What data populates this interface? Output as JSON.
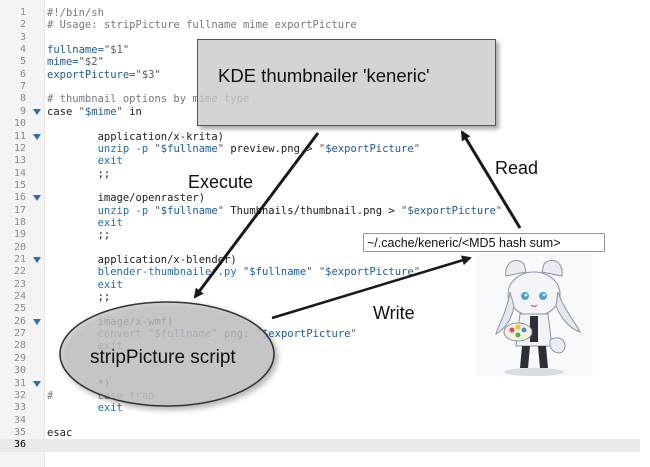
{
  "code_lines": [
    {
      "n": "1",
      "fold": false,
      "parts": [
        {
          "t": "#!/bin/sh",
          "c": "c-comment"
        }
      ]
    },
    {
      "n": "2",
      "fold": false,
      "parts": [
        {
          "t": "# Usage: stripPicture fullname mime exportPicture",
          "c": "c-comment"
        }
      ]
    },
    {
      "n": "3",
      "fold": false,
      "parts": []
    },
    {
      "n": "4",
      "fold": false,
      "parts": [
        {
          "t": "fullname=",
          "c": "c-var"
        },
        {
          "t": "\"$1\"",
          "c": "c-str"
        }
      ]
    },
    {
      "n": "5",
      "fold": false,
      "parts": [
        {
          "t": "mime=",
          "c": "c-var"
        },
        {
          "t": "\"$2\"",
          "c": "c-str"
        }
      ]
    },
    {
      "n": "6",
      "fold": false,
      "parts": [
        {
          "t": "exportPicture=",
          "c": "c-var"
        },
        {
          "t": "\"$3\"",
          "c": "c-str"
        }
      ]
    },
    {
      "n": "7",
      "fold": false,
      "parts": []
    },
    {
      "n": "8",
      "fold": false,
      "parts": [
        {
          "t": "# thumbnail options by mime type",
          "c": "c-comment"
        }
      ]
    },
    {
      "n": "9",
      "fold": true,
      "parts": [
        {
          "t": "case ",
          "c": "c-kw"
        },
        {
          "t": "\"",
          "c": "c-str"
        },
        {
          "t": "$mime",
          "c": "c-var"
        },
        {
          "t": "\"",
          "c": "c-str"
        },
        {
          "t": " in",
          "c": "c-kw"
        }
      ]
    },
    {
      "n": "10",
      "fold": false,
      "parts": []
    },
    {
      "n": "11",
      "fold": true,
      "parts": [
        {
          "t": "        application/x-krita)",
          "c": "c-kw"
        }
      ]
    },
    {
      "n": "12",
      "fold": false,
      "parts": [
        {
          "t": "        unzip -p ",
          "c": "c-cmd"
        },
        {
          "t": "\"",
          "c": "c-str"
        },
        {
          "t": "$fullname",
          "c": "c-var"
        },
        {
          "t": "\"",
          "c": "c-str"
        },
        {
          "t": " preview.png > ",
          "c": "c-kw"
        },
        {
          "t": "\"",
          "c": "c-str"
        },
        {
          "t": "$exportPicture",
          "c": "c-var"
        },
        {
          "t": "\"",
          "c": "c-str"
        }
      ]
    },
    {
      "n": "13",
      "fold": false,
      "parts": [
        {
          "t": "        exit",
          "c": "c-cmd"
        }
      ]
    },
    {
      "n": "14",
      "fold": false,
      "parts": [
        {
          "t": "        ;;",
          "c": "c-kw"
        }
      ]
    },
    {
      "n": "15",
      "fold": false,
      "parts": []
    },
    {
      "n": "16",
      "fold": true,
      "parts": [
        {
          "t": "        image/openraster)",
          "c": "c-kw"
        }
      ]
    },
    {
      "n": "17",
      "fold": false,
      "parts": [
        {
          "t": "        unzip -p ",
          "c": "c-cmd"
        },
        {
          "t": "\"",
          "c": "c-str"
        },
        {
          "t": "$fullname",
          "c": "c-var"
        },
        {
          "t": "\"",
          "c": "c-str"
        },
        {
          "t": " Thumbnails/thumbnail.png > ",
          "c": "c-kw"
        },
        {
          "t": "\"",
          "c": "c-str"
        },
        {
          "t": "$exportPicture",
          "c": "c-var"
        },
        {
          "t": "\"",
          "c": "c-str"
        }
      ]
    },
    {
      "n": "18",
      "fold": false,
      "parts": [
        {
          "t": "        exit",
          "c": "c-cmd"
        }
      ]
    },
    {
      "n": "19",
      "fold": false,
      "parts": [
        {
          "t": "        ;;",
          "c": "c-kw"
        }
      ]
    },
    {
      "n": "20",
      "fold": false,
      "parts": []
    },
    {
      "n": "21",
      "fold": true,
      "parts": [
        {
          "t": "        application/x-blender)",
          "c": "c-kw"
        }
      ]
    },
    {
      "n": "22",
      "fold": false,
      "parts": [
        {
          "t": "        blender-thumbnailer.py ",
          "c": "c-cmd"
        },
        {
          "t": "\"",
          "c": "c-str"
        },
        {
          "t": "$fullname",
          "c": "c-var"
        },
        {
          "t": "\" \"",
          "c": "c-str"
        },
        {
          "t": "$exportPicture",
          "c": "c-var"
        },
        {
          "t": "\"",
          "c": "c-str"
        }
      ]
    },
    {
      "n": "23",
      "fold": false,
      "parts": [
        {
          "t": "        exit",
          "c": "c-cmd"
        }
      ]
    },
    {
      "n": "24",
      "fold": false,
      "parts": [
        {
          "t": "        ;;",
          "c": "c-kw"
        }
      ]
    },
    {
      "n": "25",
      "fold": false,
      "parts": []
    },
    {
      "n": "26",
      "fold": true,
      "parts": [
        {
          "t": "        image/x-wmf)",
          "c": "c-kw"
        }
      ]
    },
    {
      "n": "27",
      "fold": false,
      "parts": [
        {
          "t": "        convert ",
          "c": "c-cmd"
        },
        {
          "t": "\"",
          "c": "c-str"
        },
        {
          "t": "$fullname",
          "c": "c-var"
        },
        {
          "t": "\"",
          "c": "c-str"
        },
        {
          "t": " png: ",
          "c": "c-kw"
        },
        {
          "t": "\"",
          "c": "c-str"
        },
        {
          "t": "$exportPicture",
          "c": "c-var"
        },
        {
          "t": "\"",
          "c": "c-str"
        }
      ]
    },
    {
      "n": "28",
      "fold": false,
      "parts": [
        {
          "t": "        exit",
          "c": "c-cmd"
        }
      ]
    },
    {
      "n": "29",
      "fold": false,
      "parts": [
        {
          "t": "        ;;",
          "c": "c-kw"
        }
      ]
    },
    {
      "n": "30",
      "fold": false,
      "parts": []
    },
    {
      "n": "31",
      "fold": true,
      "parts": [
        {
          "t": "        *)",
          "c": "c-kw"
        }
      ]
    },
    {
      "n": "32",
      "fold": false,
      "parts": [
        {
          "t": "#       case trap",
          "c": "c-comment"
        }
      ]
    },
    {
      "n": "33",
      "fold": false,
      "parts": [
        {
          "t": "        exit",
          "c": "c-cmd"
        }
      ]
    },
    {
      "n": "34",
      "fold": false,
      "parts": []
    },
    {
      "n": "35",
      "fold": false,
      "parts": [
        {
          "t": "esac",
          "c": "c-kw"
        }
      ]
    },
    {
      "n": "36",
      "fold": false,
      "current": true,
      "parts": []
    }
  ],
  "overlay": {
    "kde_box_label": "KDE thumbnailer 'keneric'",
    "execute_label": "Execute",
    "read_label": "Read",
    "write_label": "Write",
    "cache_path": "~/.cache/keneric/<MD5 hash sum>",
    "script_label": "stripPicture script"
  },
  "colors": {
    "fold_marker": "#2a6fb3",
    "variable": "#1a5aa6",
    "command": "#1e6fb8",
    "arrow": "#1a1a1a",
    "kde_box_fill": "#c8c8c8",
    "ellipse_fill": "#d0d0d0"
  }
}
